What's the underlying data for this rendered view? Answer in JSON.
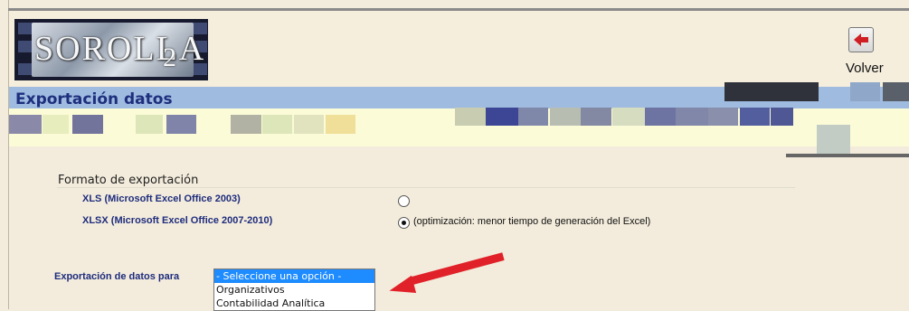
{
  "header": {
    "logo_text": "SOROLLA",
    "logo_sub": "2",
    "back_label": "Volver"
  },
  "page": {
    "title": "Exportación datos"
  },
  "export": {
    "section_title": "Formato de exportación",
    "options": [
      {
        "label": "XLS (Microsoft Excel Office 2003)",
        "selected": false
      },
      {
        "label": "XLSX (Microsoft Excel Office 2007-2010)",
        "selected": true,
        "note": "(optimización: menor tiempo de generación del Excel)"
      }
    ],
    "data_for_label": "Exportación de datos para",
    "select_options": [
      "- Seleccione una opción -",
      "Organizativos",
      "Contabilidad Analítica"
    ]
  },
  "colors": {
    "title_band": "#9fbbe0",
    "title_text": "#1d2f7d",
    "highlight": "#1e8cff",
    "annotation_arrow": "#e12129"
  }
}
